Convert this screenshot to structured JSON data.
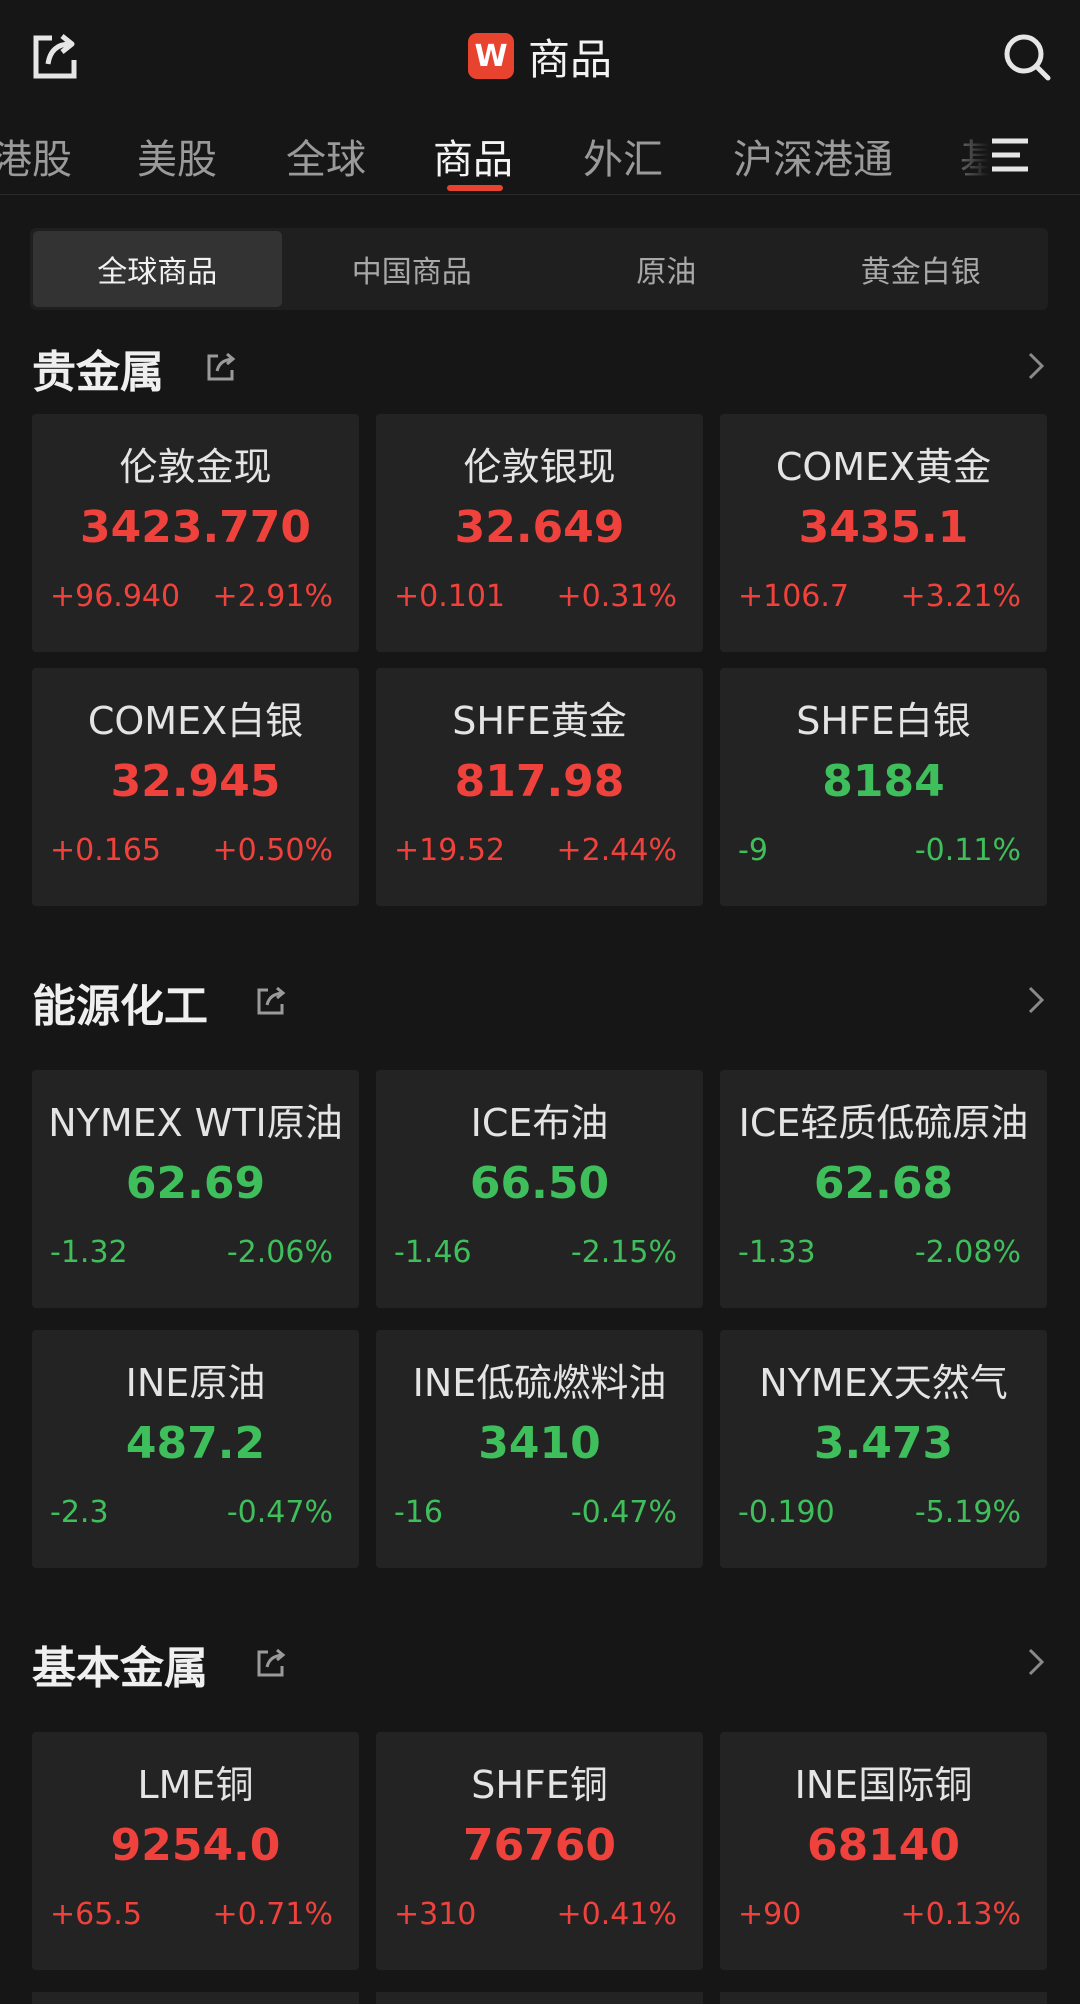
{
  "header": {
    "logo_text": "W",
    "title": "商品"
  },
  "tabs": [
    "港股",
    "美股",
    "全球",
    "商品",
    "外汇",
    "沪深港通",
    "基"
  ],
  "segments": [
    "全球商品",
    "中国商品",
    "原油",
    "黄金白银"
  ],
  "sections": [
    {
      "title": "贵金属",
      "cards": [
        {
          "name": "伦敦金现",
          "price": "3423.770",
          "change": "+96.940",
          "pct": "+2.91%",
          "dir": "up"
        },
        {
          "name": "伦敦银现",
          "price": "32.649",
          "change": "+0.101",
          "pct": "+0.31%",
          "dir": "up"
        },
        {
          "name": "COMEX黄金",
          "price": "3435.1",
          "change": "+106.7",
          "pct": "+3.21%",
          "dir": "up"
        },
        {
          "name": "COMEX白银",
          "price": "32.945",
          "change": "+0.165",
          "pct": "+0.50%",
          "dir": "up"
        },
        {
          "name": "SHFE黄金",
          "price": "817.98",
          "change": "+19.52",
          "pct": "+2.44%",
          "dir": "up"
        },
        {
          "name": "SHFE白银",
          "price": "8184",
          "change": "-9",
          "pct": "-0.11%",
          "dir": "down"
        }
      ]
    },
    {
      "title": "能源化工",
      "cards": [
        {
          "name": "NYMEX WTI原油",
          "price": "62.69",
          "change": "-1.32",
          "pct": "-2.06%",
          "dir": "down"
        },
        {
          "name": "ICE布油",
          "price": "66.50",
          "change": "-1.46",
          "pct": "-2.15%",
          "dir": "down"
        },
        {
          "name": "ICE轻质低硫原油",
          "price": "62.68",
          "change": "-1.33",
          "pct": "-2.08%",
          "dir": "down"
        },
        {
          "name": "INE原油",
          "price": "487.2",
          "change": "-2.3",
          "pct": "-0.47%",
          "dir": "down"
        },
        {
          "name": "INE低硫燃料油",
          "price": "3410",
          "change": "-16",
          "pct": "-0.47%",
          "dir": "down"
        },
        {
          "name": "NYMEX天然气",
          "price": "3.473",
          "change": "-0.190",
          "pct": "-5.19%",
          "dir": "down"
        }
      ]
    },
    {
      "title": "基本金属",
      "cards": [
        {
          "name": "LME铜",
          "price": "9254.0",
          "change": "+65.5",
          "pct": "+0.71%",
          "dir": "up"
        },
        {
          "name": "SHFE铜",
          "price": "76760",
          "change": "+310",
          "pct": "+0.41%",
          "dir": "up"
        },
        {
          "name": "INE国际铜",
          "price": "68140",
          "change": "+90",
          "pct": "+0.13%",
          "dir": "up"
        }
      ]
    }
  ],
  "colors": {
    "up": "#f0423c",
    "down": "#3fbf5b",
    "accent": "#e8432f"
  }
}
